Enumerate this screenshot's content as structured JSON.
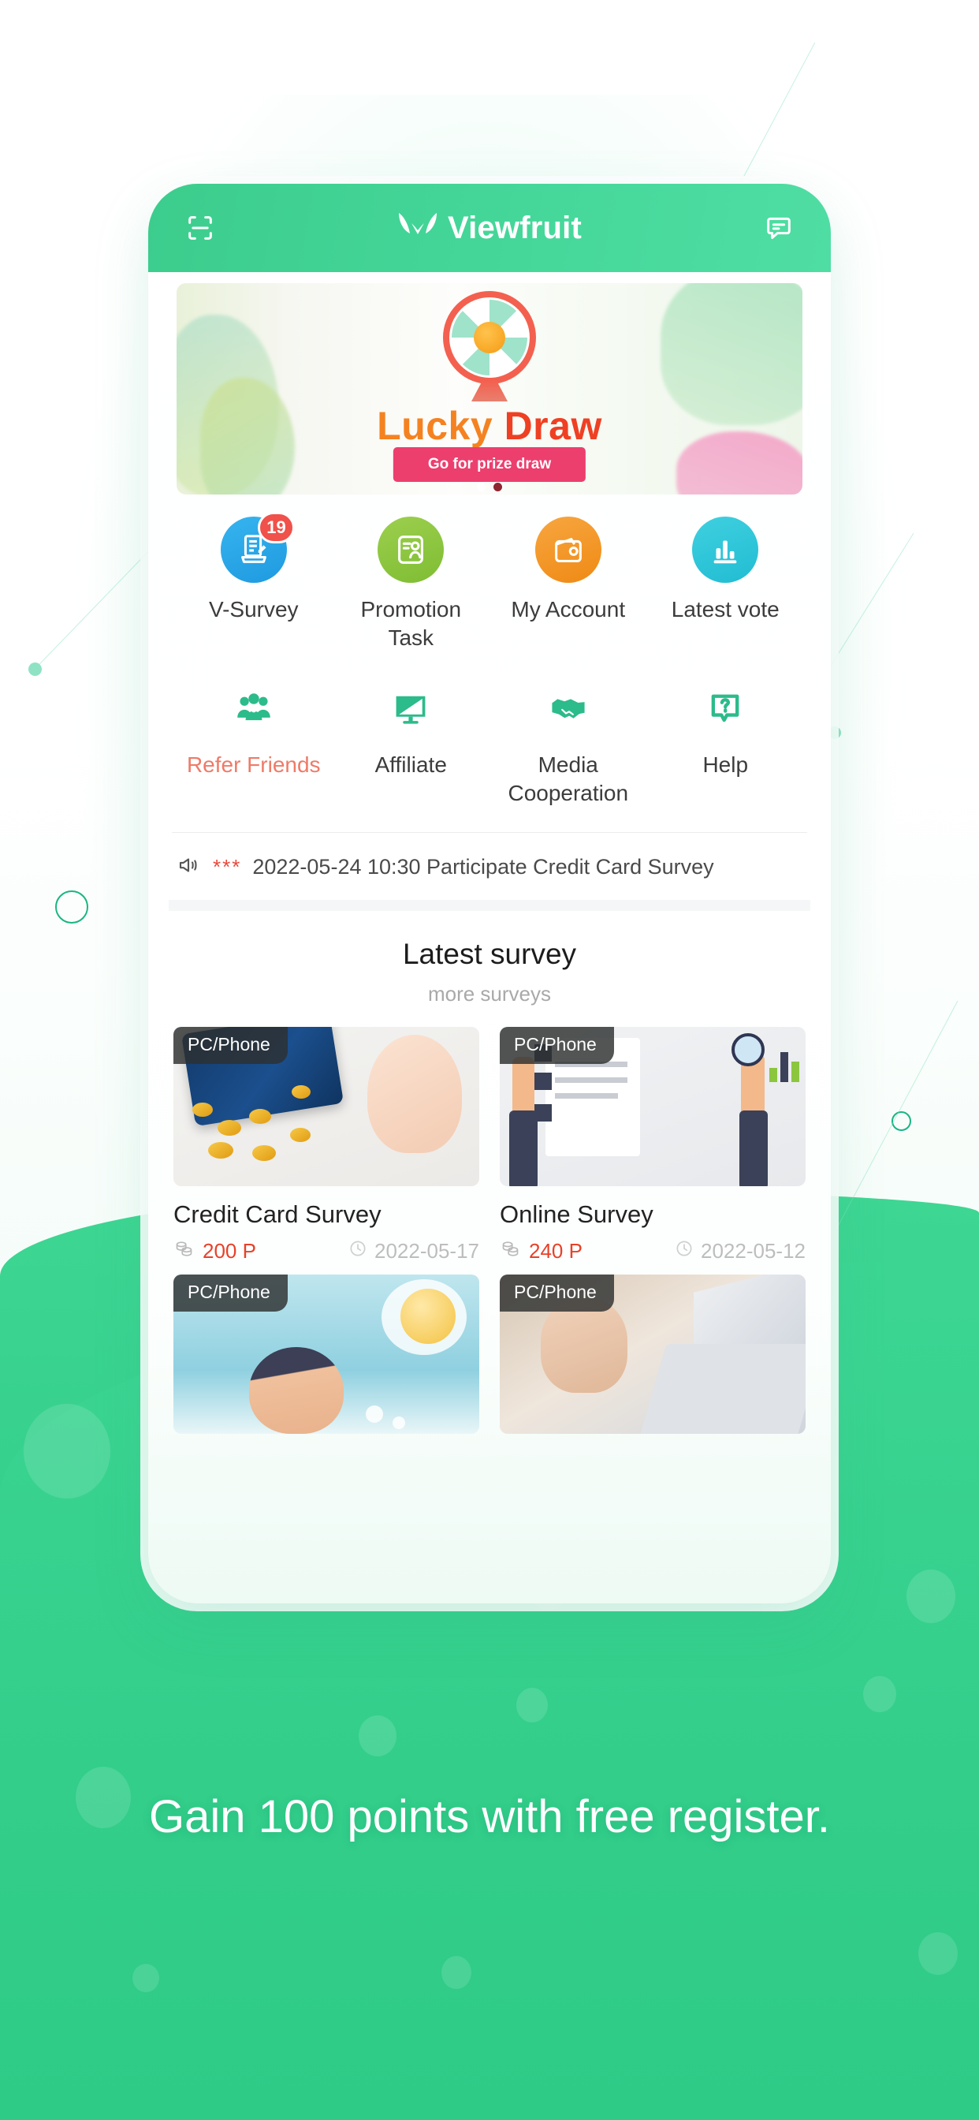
{
  "app": {
    "brand_name": "Viewfruit",
    "scan_icon": "scan-icon",
    "message_icon": "message-icon",
    "logo_icon": "leaf-logo-icon"
  },
  "banner": {
    "title_part1": "Lucky",
    "title_part2": "Draw",
    "cta_label": "Go for prize draw",
    "slide_count": 2,
    "active_slide": 1
  },
  "menu": {
    "row1": [
      {
        "label": "V-Survey",
        "icon": "survey-document-icon",
        "color": "#2aa7e8",
        "badge": "19"
      },
      {
        "label": "Promotion Task",
        "icon": "contact-card-icon",
        "color": "#8cc63f",
        "badge": ""
      },
      {
        "label": "My Account",
        "icon": "wallet-icon",
        "color": "#f3941d",
        "badge": ""
      },
      {
        "label": "Latest vote",
        "icon": "bar-chart-icon",
        "color": "#2ec4d8",
        "badge": ""
      }
    ],
    "row2": [
      {
        "label": "Refer Friends",
        "icon": "group-people-icon",
        "color": "#2cbb8b",
        "accent": true
      },
      {
        "label": "Affiliate",
        "icon": "monitor-icon",
        "color": "#2cbb8b",
        "accent": false
      },
      {
        "label": "Media Cooperation",
        "icon": "handshake-icon",
        "color": "#2cbb8b",
        "accent": false
      },
      {
        "label": "Help",
        "icon": "question-bubble-icon",
        "color": "#2cbb8b",
        "accent": false
      }
    ]
  },
  "notice": {
    "speaker_icon": "speaker-icon",
    "stars": "***",
    "text": "2022-05-24 10:30 Participate Credit Card Survey"
  },
  "latest": {
    "title": "Latest survey",
    "more_label": "more surveys",
    "cards": [
      {
        "tag": "PC/Phone",
        "title": "Credit Card Survey",
        "points": "200 P",
        "date": "2022-05-17",
        "art": "credit-card"
      },
      {
        "tag": "PC/Phone",
        "title": "Online Survey",
        "points": "240 P",
        "date": "2022-05-12",
        "art": "online-survey"
      },
      {
        "tag": "PC/Phone",
        "title": "",
        "points": "",
        "date": "",
        "art": "idea"
      },
      {
        "tag": "PC/Phone",
        "title": "",
        "points": "",
        "date": "",
        "art": "typing"
      }
    ]
  },
  "promo": {
    "tagline": "Gain 100 points with free register."
  },
  "colors": {
    "brand_green": "#3ccd8d",
    "accent_red": "#e8412a",
    "badge_red": "#f0514a",
    "cta_pink": "#ec3f6e",
    "refer_salmon": "#ef7a68"
  }
}
